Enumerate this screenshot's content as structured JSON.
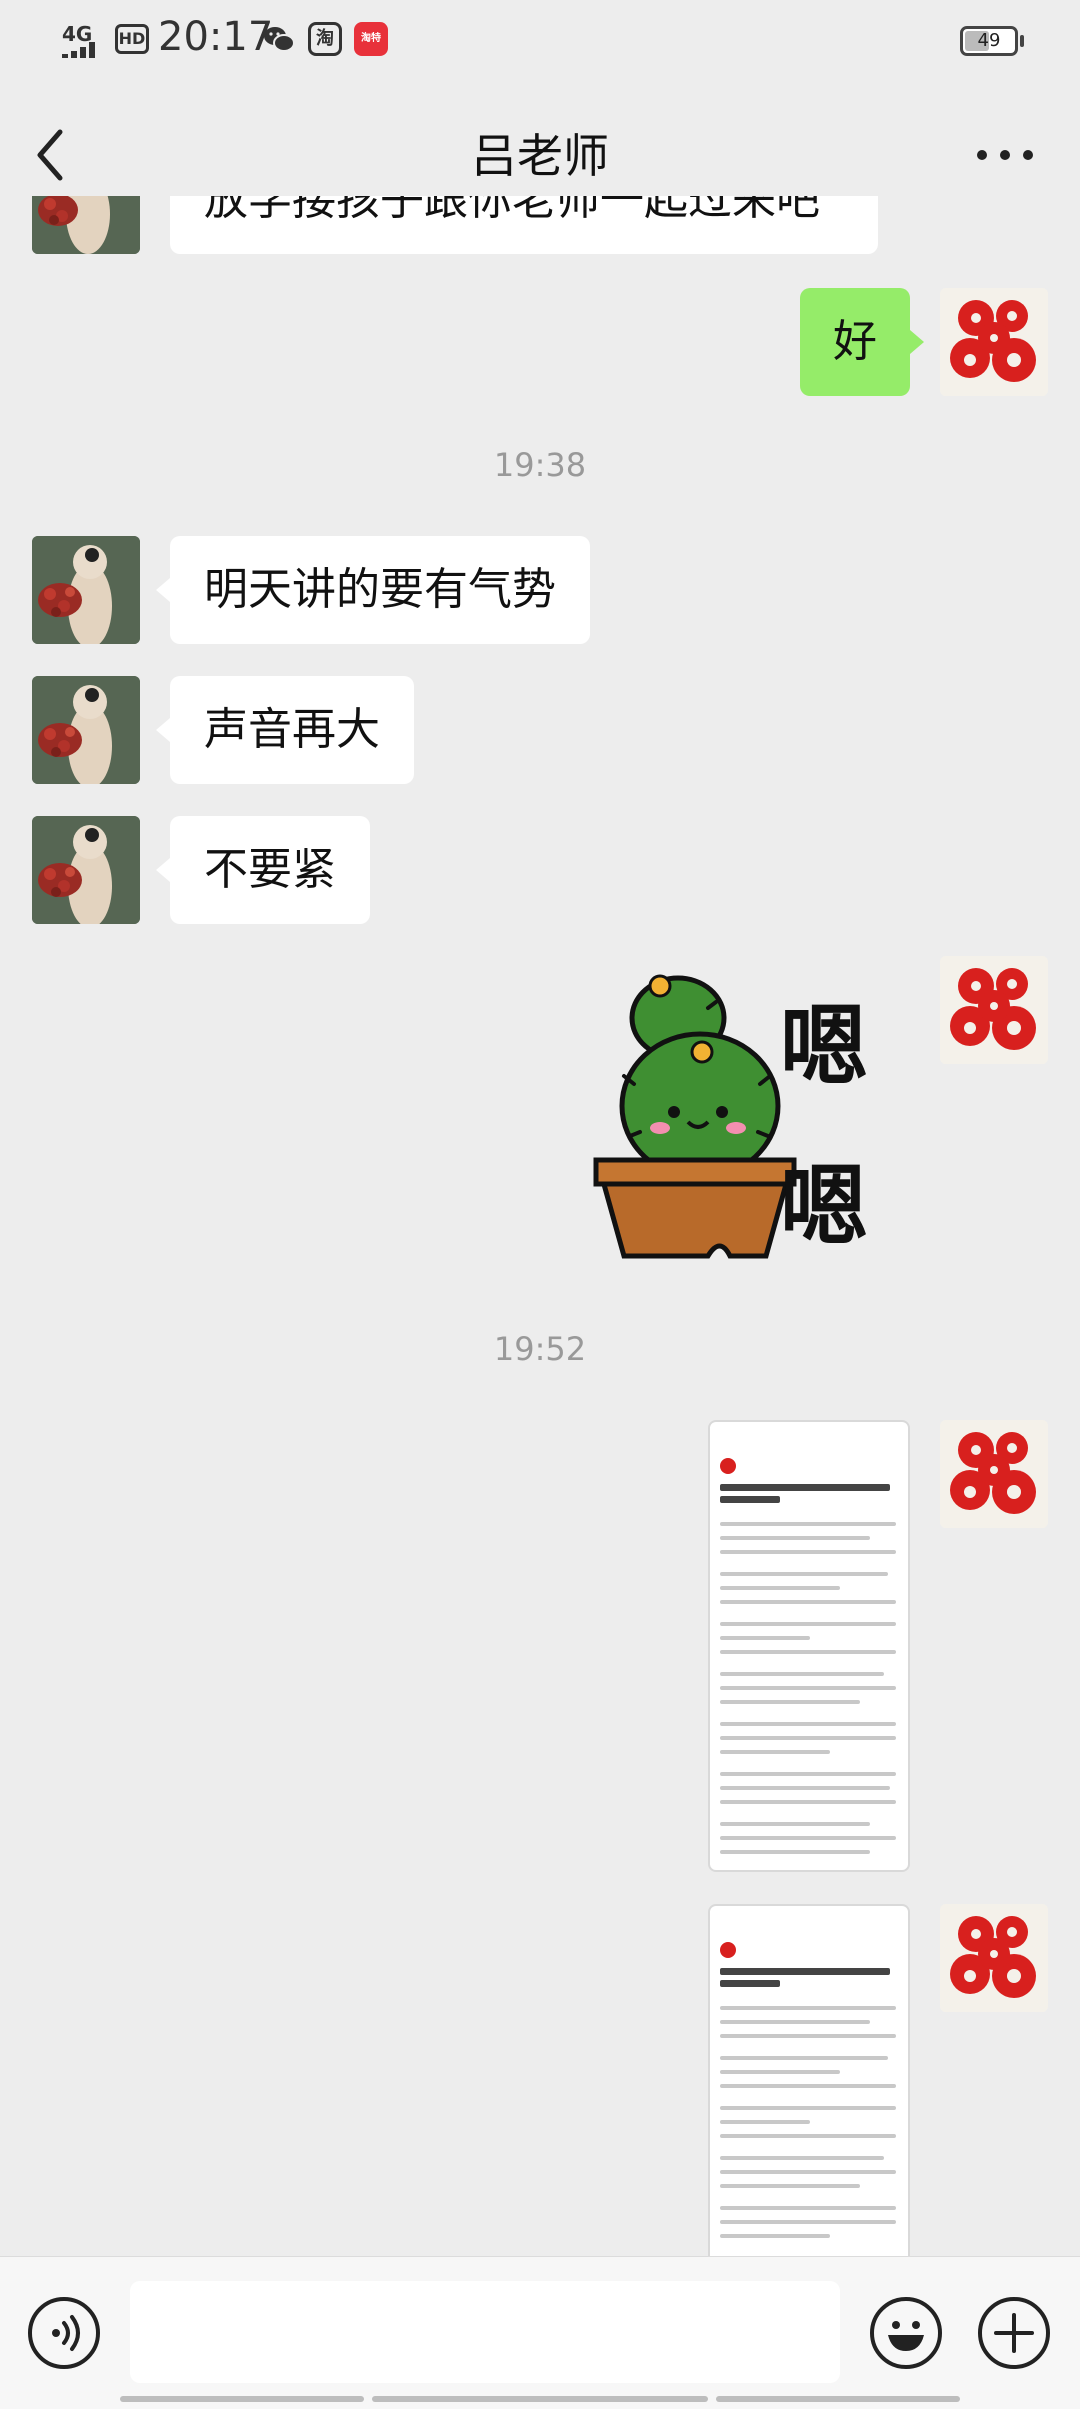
{
  "status_bar": {
    "network": "4G",
    "hd": "HD",
    "time": "20:17",
    "app_icons": [
      "wechat-icon",
      "taobao-icon",
      "taote-icon"
    ],
    "taobao_char": "淘",
    "taote_char": "淘特",
    "battery": "49",
    "battery_level": 0.49
  },
  "header": {
    "title": "吕老师"
  },
  "chat": {
    "partial_message": "放学接孩子跟你老师一起过来吧",
    "messages": [
      {
        "side": "right",
        "text": "好"
      },
      {
        "type": "time",
        "text": "19:38"
      },
      {
        "side": "left",
        "text": "明天讲的要有气势"
      },
      {
        "side": "left",
        "text": "声音再大"
      },
      {
        "side": "left",
        "text": "不要紧"
      },
      {
        "side": "right",
        "type": "sticker",
        "sticker_text_1": "嗯",
        "sticker_text_2": "嗯"
      },
      {
        "type": "time",
        "text": "19:52"
      },
      {
        "side": "right",
        "type": "image",
        "name": "article-screenshot-1"
      },
      {
        "side": "right",
        "type": "image",
        "name": "article-screenshot-2"
      }
    ]
  },
  "input": {
    "placeholder": ""
  },
  "colors": {
    "background": "#ededed",
    "bubble_self": "#95ec69",
    "bubble_other": "#ffffff"
  }
}
